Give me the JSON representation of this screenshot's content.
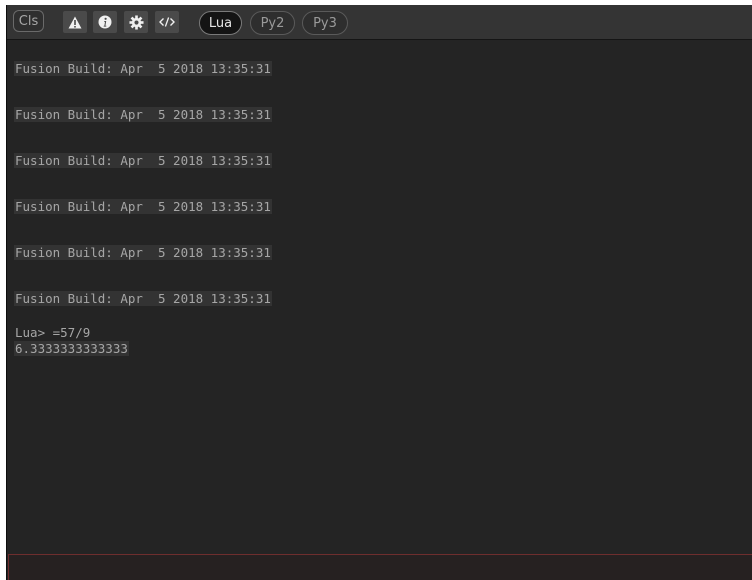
{
  "toolbar": {
    "clear_label": "Cls",
    "icons": [
      "warning-icon",
      "info-icon",
      "gear-icon",
      "code-icon"
    ],
    "tabs": [
      {
        "label": "Lua",
        "active": true
      },
      {
        "label": "Py2",
        "active": false
      },
      {
        "label": "Py3",
        "active": false
      }
    ]
  },
  "console": {
    "build_lines": [
      "Fusion Build: Apr  5 2018 13:35:31",
      "Fusion Build: Apr  5 2018 13:35:31",
      "Fusion Build: Apr  5 2018 13:35:31",
      "Fusion Build: Apr  5 2018 13:35:31",
      "Fusion Build: Apr  5 2018 13:35:31",
      "Fusion Build: Apr  5 2018 13:35:31"
    ],
    "command": "Lua> =57/9",
    "result": "6.3333333333333"
  },
  "input": {
    "value": ""
  },
  "colors": {
    "background": "#242424",
    "toolbar": "#343434",
    "text": "#a6a6a6",
    "input_border": "#6e2e2e"
  }
}
